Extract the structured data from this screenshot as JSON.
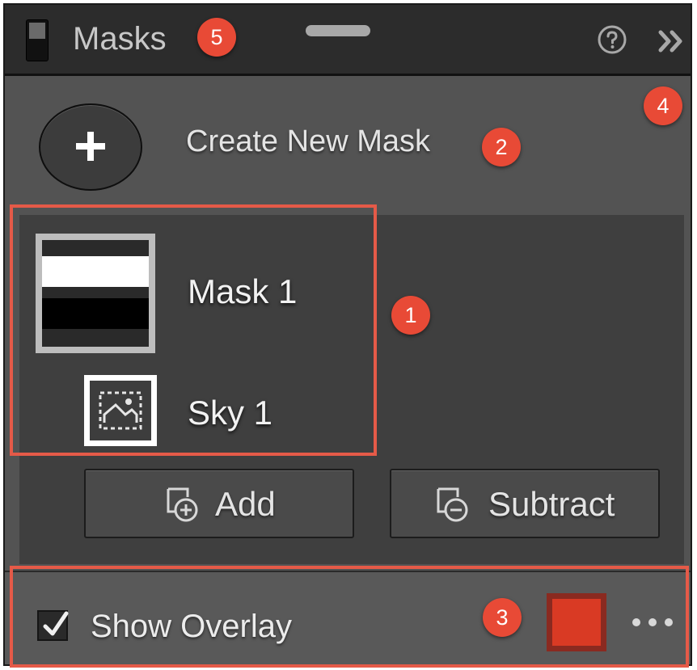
{
  "header": {
    "title": "Masks",
    "help_icon": "help-circle-icon",
    "collapse_icon": "double-chevron-right-icon"
  },
  "create": {
    "icon": "plus-icon",
    "label": "Create New Mask"
  },
  "masks": [
    {
      "name": "Mask 1",
      "thumb": "mask-gradient-thumbnail"
    },
    {
      "name": "Sky 1",
      "thumb": "sky-mask-icon"
    }
  ],
  "actions": {
    "add_label": "Add",
    "add_icon": "mask-add-icon",
    "subtract_label": "Subtract",
    "subtract_icon": "mask-subtract-icon"
  },
  "overlay": {
    "label": "Show Overlay",
    "checked": true,
    "color": "#d93a24",
    "more_icon": "more-horizontal-icon"
  },
  "callouts": [
    "1",
    "2",
    "3",
    "4",
    "5"
  ],
  "colors": {
    "panel": "#535353",
    "header": "#2c2c2c",
    "callout": "#e84a36",
    "highlight": "#e55a48"
  }
}
